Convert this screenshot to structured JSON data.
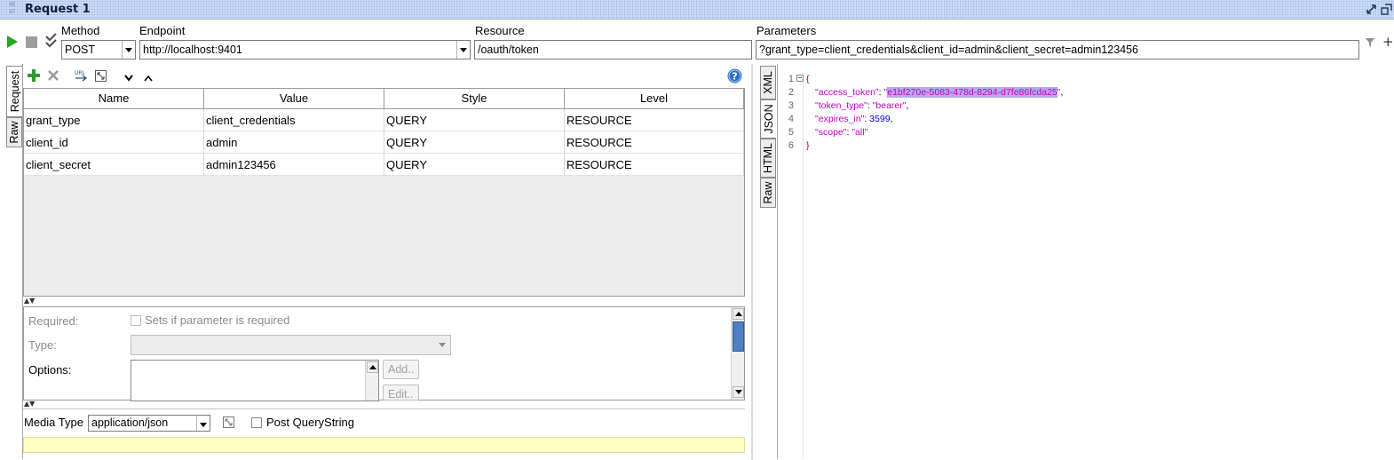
{
  "window": {
    "badge": "RE ST",
    "title": "Request 1"
  },
  "toolbar": {
    "method_label": "Method",
    "method_value": "POST",
    "endpoint_label": "Endpoint",
    "endpoint_value": "http://localhost:9401",
    "resource_label": "Resource",
    "resource_value": "/oauth/token",
    "parameters_label": "Parameters",
    "parameters_value": "?grant_type=client_credentials&client_id=admin&client_secret=admin123456"
  },
  "left_tabs": [
    "Request",
    "Raw"
  ],
  "params_table": {
    "headers": [
      "Name",
      "Value",
      "Style",
      "Level"
    ],
    "rows": [
      [
        "grant_type",
        "client_credentials",
        "QUERY",
        "RESOURCE"
      ],
      [
        "client_id",
        "admin",
        "QUERY",
        "RESOURCE"
      ],
      [
        "client_secret",
        "admin123456",
        "QUERY",
        "RESOURCE"
      ]
    ]
  },
  "detail": {
    "required_label": "Required:",
    "required_checkbox": "Sets if parameter is required",
    "type_label": "Type:",
    "options_label": "Options:",
    "add_button": "Add..",
    "edit_button": "Edit.."
  },
  "media": {
    "label": "Media Type",
    "value": "application/json",
    "post_querystring": "Post QueryString"
  },
  "right_tabs": [
    "XML",
    "JSON",
    "HTML",
    "Raw"
  ],
  "response": {
    "line_numbers": [
      "1",
      "2",
      "3",
      "4",
      "5",
      "6"
    ],
    "open_brace": "{",
    "close_brace": "}",
    "access_token_key": "\"access_token\"",
    "access_token_value": "e1bf270e-5083-478d-8294-d7fe86fcda25",
    "token_type_key": "\"token_type\"",
    "token_type_value": "\"bearer\"",
    "expires_in_key": "\"expires_in\"",
    "expires_in_value": "3599",
    "scope_key": "\"scope\"",
    "scope_value": "\"all\""
  },
  "colors": {
    "titlebar": "#cfdff5",
    "media_strip": "#ffffc0",
    "json_key": "#c000c0",
    "json_number": "#0000cc",
    "selection": "#b7a8f0"
  },
  "icons": [
    "play-icon",
    "stop-icon",
    "check-icon",
    "plus-icon",
    "delete-icon",
    "url-icon",
    "resize-icon",
    "move-down-icon",
    "move-up-icon",
    "help-icon",
    "restore-icon",
    "float-icon",
    "clear-icon",
    "add-icon"
  ]
}
